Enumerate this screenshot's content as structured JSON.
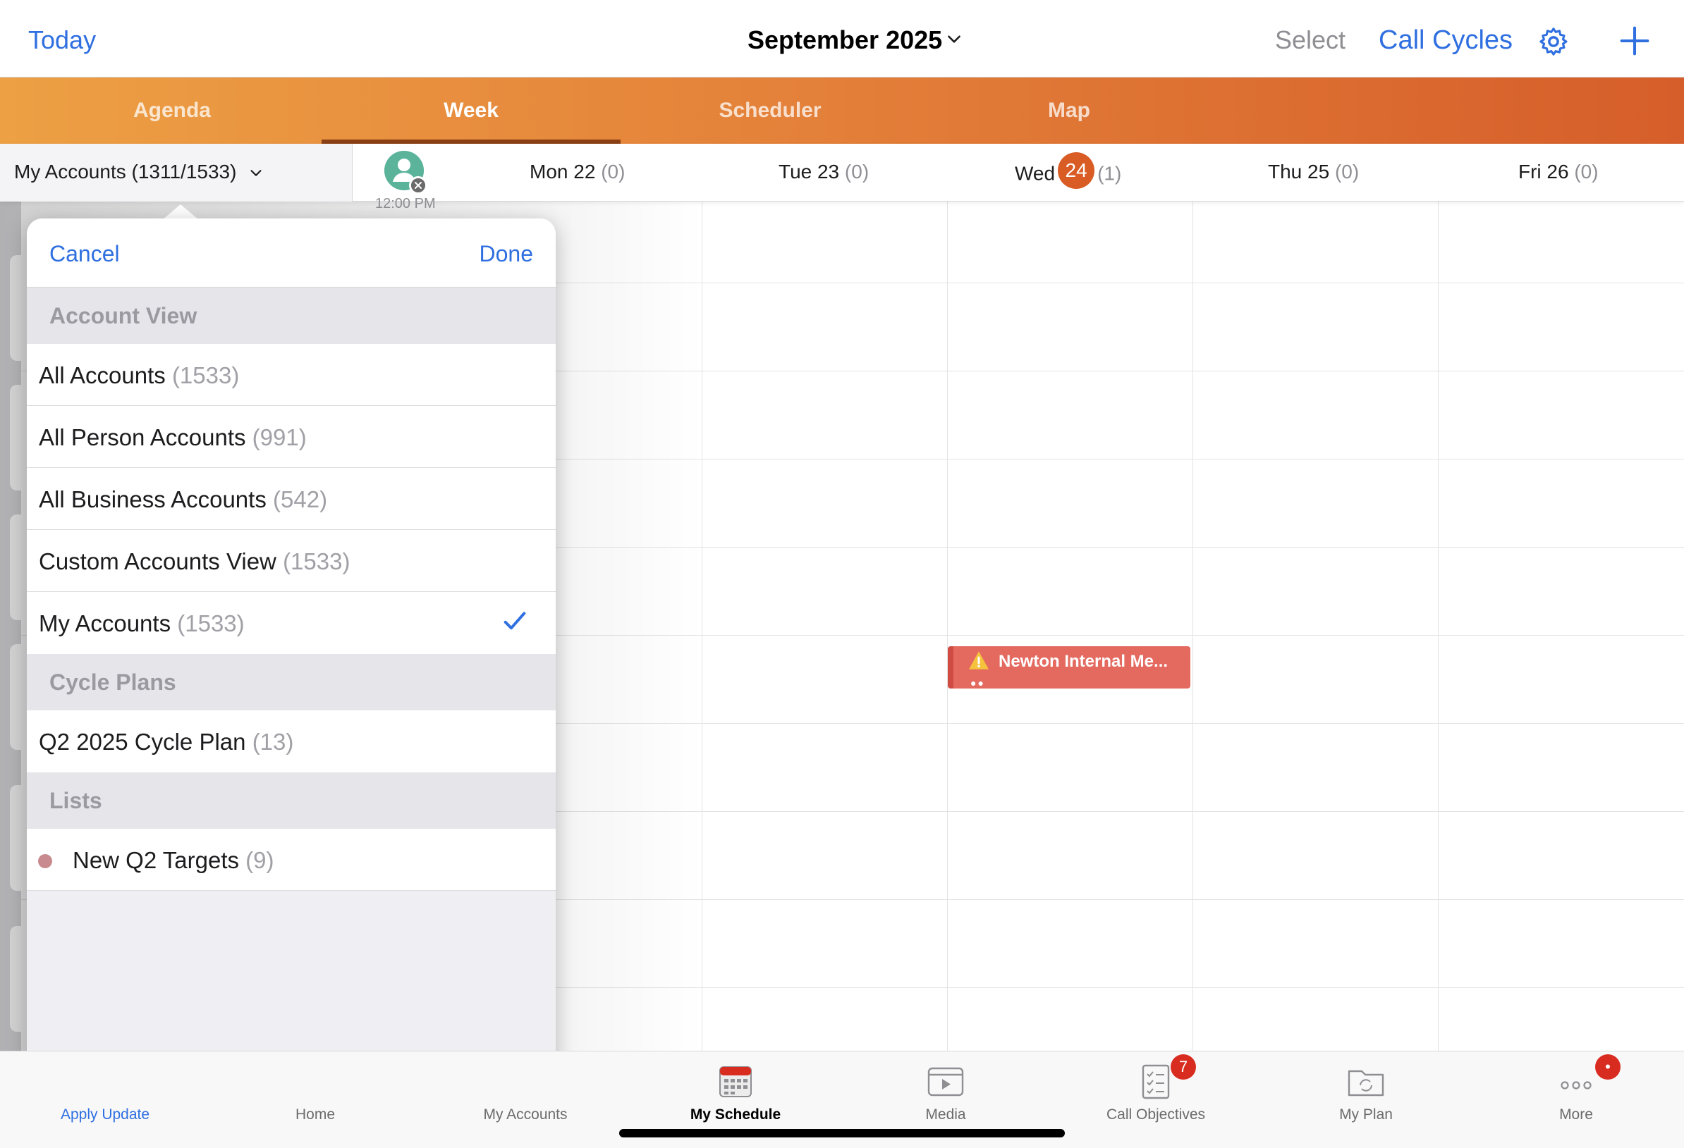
{
  "topbar": {
    "today_label": "Today",
    "month_title": "September 2025",
    "select_label": "Select",
    "call_cycles_label": "Call Cycles"
  },
  "tabs": [
    {
      "label": "Agenda",
      "active": false
    },
    {
      "label": "Week",
      "active": true
    },
    {
      "label": "Scheduler",
      "active": false
    },
    {
      "label": "Map",
      "active": false
    }
  ],
  "filter": {
    "label": "My Accounts (1311/1533)"
  },
  "time_label": "12:00 PM",
  "days": [
    {
      "name": "Mon 22",
      "count": "(0)"
    },
    {
      "name": "Tue 23",
      "count": "(0)"
    },
    {
      "weekday": "Wed",
      "date": "24",
      "count": "(1)",
      "today": true
    },
    {
      "name": "Thu 25",
      "count": "(0)"
    },
    {
      "name": "Fri 26",
      "count": "(0)"
    }
  ],
  "event": {
    "title": "Newton Internal Me...",
    "color": "#e46a60"
  },
  "popover": {
    "cancel_label": "Cancel",
    "done_label": "Done",
    "sections": [
      {
        "title": "Account View",
        "rows": [
          {
            "label": "All Accounts",
            "count": "(1533)"
          },
          {
            "label": "All Person Accounts",
            "count": "(991)"
          },
          {
            "label": "All Business Accounts",
            "count": "(542)"
          },
          {
            "label": "Custom Accounts View",
            "count": "(1533)"
          },
          {
            "label": "My Accounts",
            "count": "(1533)",
            "selected": true
          }
        ]
      },
      {
        "title": "Cycle Plans",
        "rows": [
          {
            "label": "Q2 2025 Cycle Plan",
            "count": "(13)"
          }
        ]
      },
      {
        "title": "Lists",
        "rows": [
          {
            "label": "New Q2 Targets",
            "count": "(9)",
            "dot_color": "#c98a8f"
          }
        ]
      }
    ]
  },
  "bottom_tabs": [
    {
      "label": "Apply Update",
      "icon": "download-icon"
    },
    {
      "label": "Home",
      "icon": "home-icon"
    },
    {
      "label": "My Accounts",
      "icon": "accounts-icon"
    },
    {
      "label": "My Schedule",
      "icon": "calendar-icon",
      "active": true
    },
    {
      "label": "Media",
      "icon": "media-icon"
    },
    {
      "label": "Call Objectives",
      "icon": "checklist-icon",
      "badge": "7"
    },
    {
      "label": "My Plan",
      "icon": "folder-icon"
    },
    {
      "label": "More",
      "icon": "more-icon",
      "badge": "•"
    }
  ],
  "colors": {
    "accent_blue": "#2f6fe0",
    "tab_orange_start": "#eda044",
    "tab_orange_end": "#d65e2a",
    "today_badge": "#d95c25",
    "badge_red": "#d92c20"
  }
}
